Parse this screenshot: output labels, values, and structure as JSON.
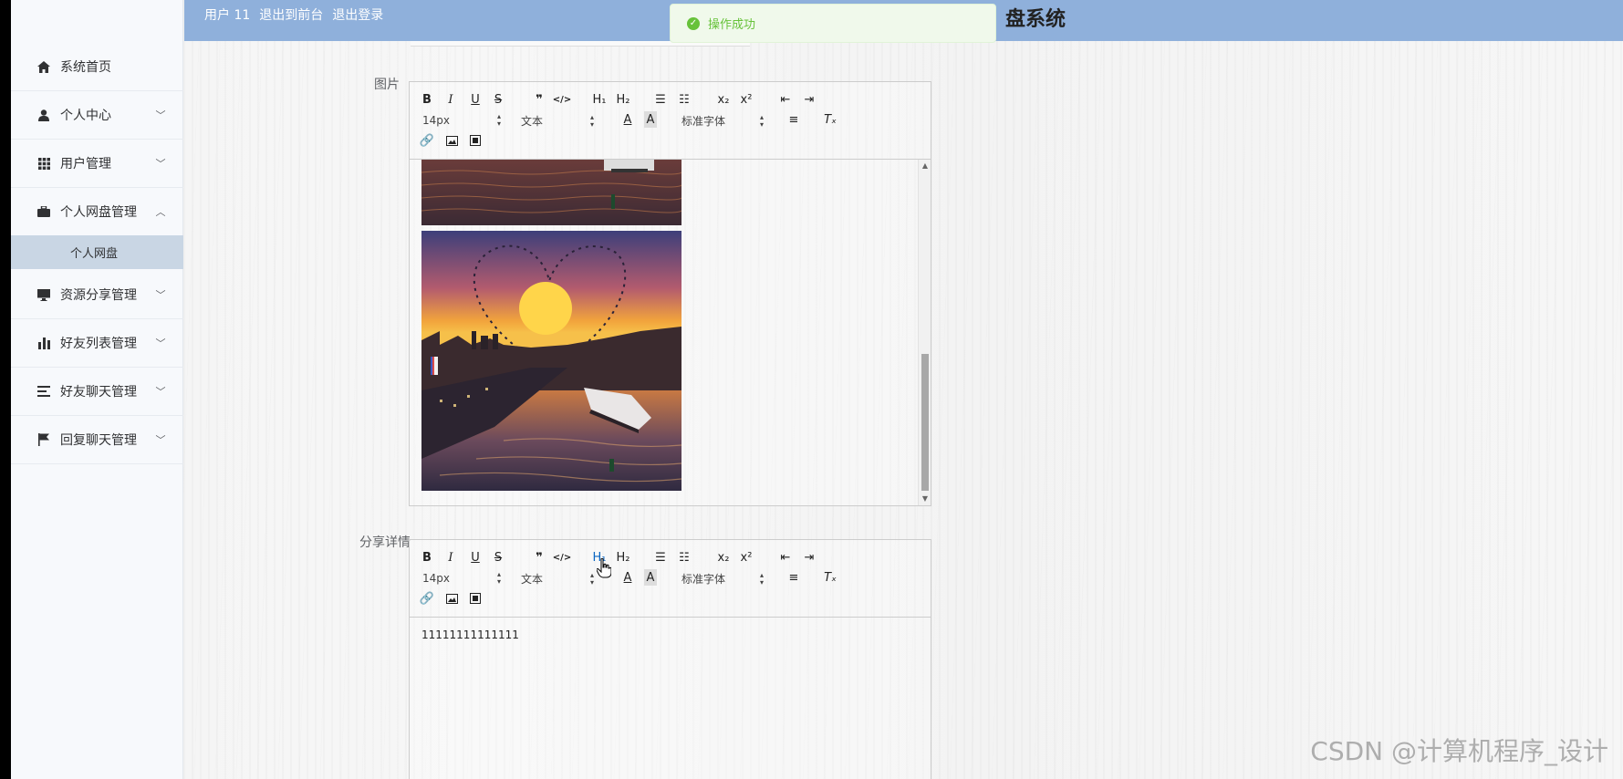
{
  "header": {
    "user_label": "用户 11",
    "back_to_front": "退出到前台",
    "logout": "退出登录",
    "title_fragment": "盘系统"
  },
  "toast": {
    "message": "操作成功",
    "status_color": "#67c23a"
  },
  "sidebar": {
    "items": [
      {
        "label": "系统首页",
        "icon": "home-icon"
      },
      {
        "label": "个人中心",
        "icon": "user-icon"
      },
      {
        "label": "用户管理",
        "icon": "grid-icon"
      },
      {
        "label": "个人网盘管理",
        "icon": "briefcase-icon",
        "expanded": true
      },
      {
        "label": "资源分享管理",
        "icon": "monitor-icon"
      },
      {
        "label": "好友列表管理",
        "icon": "bar-chart-icon"
      },
      {
        "label": "好友聊天管理",
        "icon": "list-icon"
      },
      {
        "label": "回复聊天管理",
        "icon": "flag-icon"
      }
    ],
    "submenu": {
      "label": "个人网盘",
      "active": true
    }
  },
  "form": {
    "image_label": "图片",
    "detail_label": "分享详情",
    "detail_content": "11111111111111"
  },
  "toolbar": {
    "font_size": "14px",
    "text_type": "文本",
    "font_family": "标准字体"
  },
  "watermark": "CSDN @计算机程序_设计",
  "colors": {
    "header": "#8fb0db",
    "active_submenu": "#c9d6e4",
    "accent": "#0a66c2"
  }
}
